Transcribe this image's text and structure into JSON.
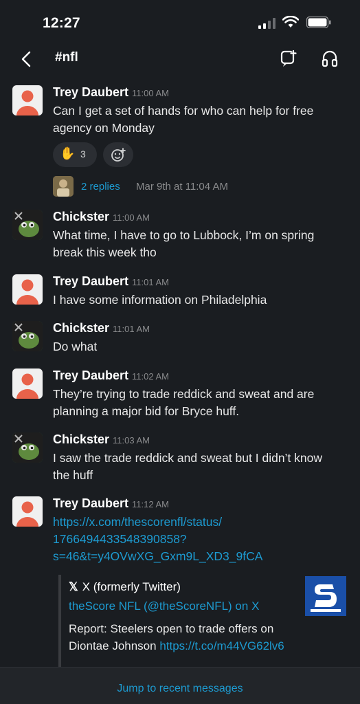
{
  "status_bar": {
    "time": "12:27"
  },
  "header": {
    "channel_name": "#nfl"
  },
  "messages": [
    {
      "sender": "Trey Daubert",
      "time": "11:00 AM",
      "text": "Can I get a set of hands for who can help for free agency on Monday",
      "reaction": {
        "emoji": "✋",
        "count": "3"
      },
      "thread": {
        "replies": "2 replies",
        "date": "Mar 9th at 11:04 AM"
      }
    },
    {
      "sender": "Chickster",
      "time": "11:00 AM",
      "text": "What time, I have to go to Lubbock, I’m on spring break this week tho"
    },
    {
      "sender": "Trey Daubert",
      "time": "11:01 AM",
      "text": "I have some information on Philadelphia"
    },
    {
      "sender": "Chickster",
      "time": "11:01 AM",
      "text": "Do what"
    },
    {
      "sender": "Trey Daubert",
      "time": "11:02 AM",
      "text": "They’re trying to trade reddick and sweat and are planning a major bid for Bryce huff."
    },
    {
      "sender": "Chickster",
      "time": "11:03 AM",
      "text": "I saw the trade reddick and sweat but I didn’t know the huff"
    },
    {
      "sender": "Trey Daubert",
      "time": "11:12 AM",
      "link_line1": "https://x.com/thescorenfl/status/",
      "link_line2": "1766494433548390858?",
      "link_line3": "s=46&t=y4OVwXG_Gxm9L_XD3_9fCA",
      "unfurl": {
        "source": "X (formerly Twitter)",
        "title": "theScore NFL (@theScoreNFL) on X",
        "body": "Report: Steelers open to trade offers on Diontae Johnson ",
        "body_link": "https://t.co/m44VG62lv6"
      }
    }
  ],
  "footer": {
    "jump_label": "Jump to recent messages"
  },
  "icons": {
    "back": "chevron-left-icon",
    "huddle": "huddle-icon",
    "headphones": "headphones-icon",
    "signal": "cellular-signal-icon",
    "wifi": "wifi-icon",
    "battery": "battery-icon",
    "add_reaction": "add-emoji-icon",
    "x_logo": "x-logo-icon"
  },
  "colors": {
    "background": "#1a1d21",
    "link": "#1d9bd1",
    "text": "#e8e8e8",
    "muted": "#8a8b8d"
  }
}
